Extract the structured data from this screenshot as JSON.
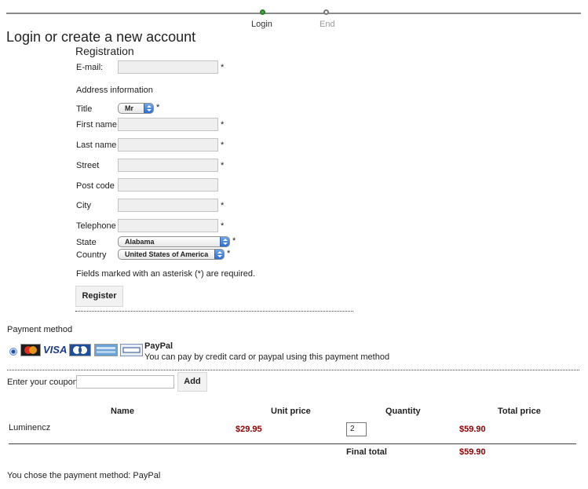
{
  "steps": [
    {
      "label": "Login",
      "active": true
    },
    {
      "label": "End",
      "active": false
    }
  ],
  "page_title": "Login or create a new account",
  "registration": {
    "title": "Registration",
    "email_label": "E-mail:",
    "address_heading": "Address information",
    "title_label": "Title",
    "title_value": "Mr",
    "first_name_label": "First name",
    "last_name_label": "Last name",
    "street_label": "Street",
    "post_code_label": "Post code",
    "city_label": "City",
    "telephone_label": "Telephone",
    "state_label": "State",
    "state_value": "Alabama",
    "country_label": "Country",
    "country_value": "United States of America",
    "required_star": "*",
    "required_note": "Fields marked with an asterisk (*) are required.",
    "register_button": "Register"
  },
  "payment": {
    "heading": "Payment method",
    "cards": [
      "MasterCard",
      "VISA",
      "JCB",
      "AMERICAN EXPRESS",
      "PayPal"
    ],
    "method_name": "PayPal",
    "method_description": "You can pay by credit card or paypal using this payment method"
  },
  "coupon": {
    "label": "Enter your coupon",
    "value": "",
    "add_button": "Add"
  },
  "cart": {
    "headers": {
      "name": "Name",
      "unit_price": "Unit price",
      "quantity": "Quantity",
      "total_price": "Total price"
    },
    "rows": [
      {
        "name": "Luminencz",
        "unit_price": "$29.95",
        "quantity": "2",
        "total_price": "$59.90"
      }
    ],
    "final_total_label": "Final total",
    "final_total_value": "$59.90"
  },
  "chosen_method_text": "You chose the payment method: PayPal",
  "colors": {
    "price": "#8b0000",
    "active_step": "#43b43e"
  }
}
